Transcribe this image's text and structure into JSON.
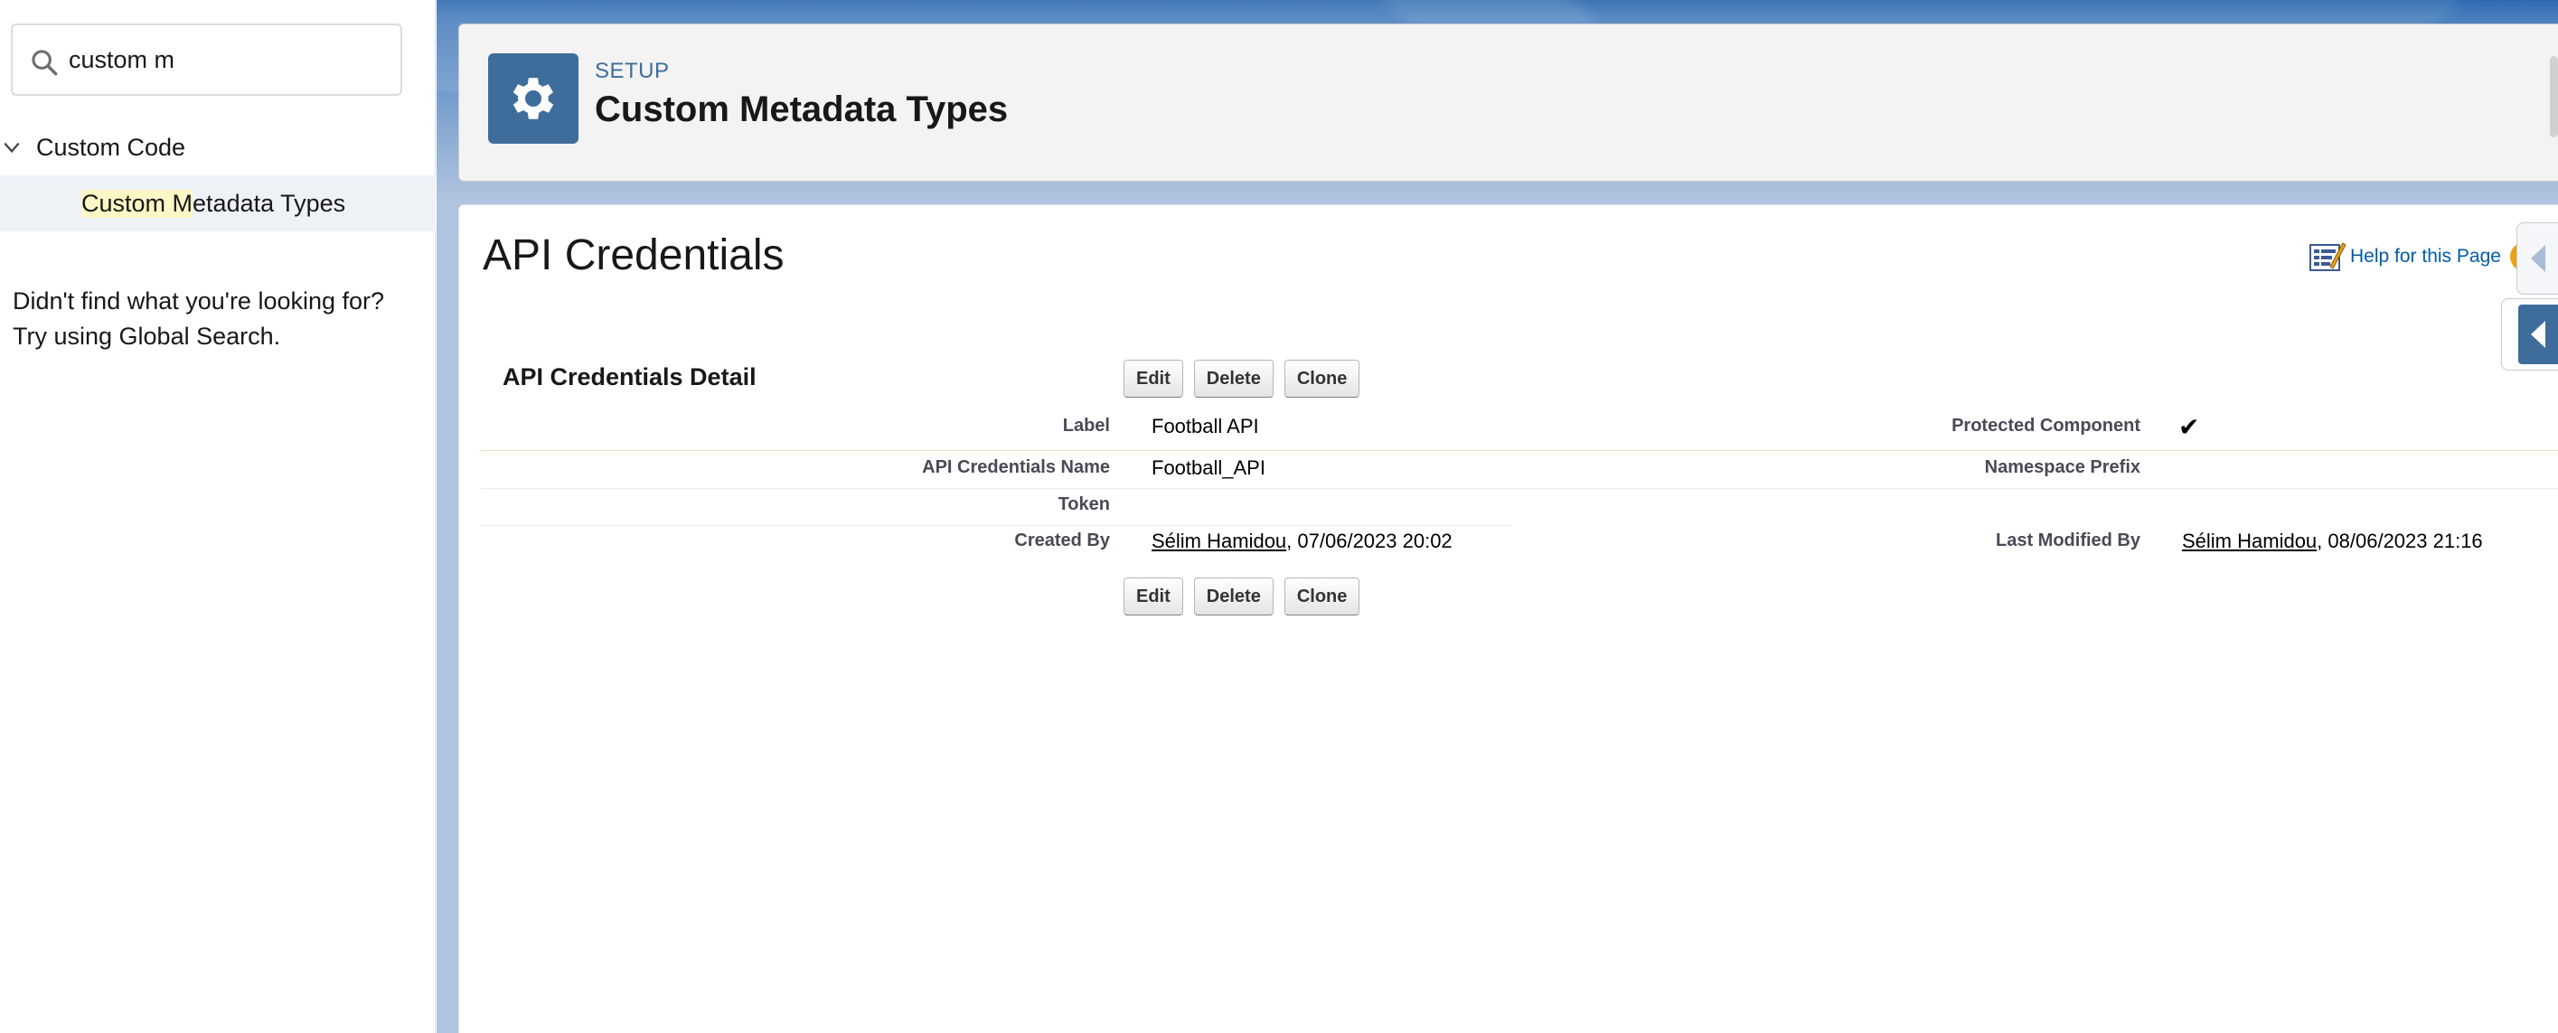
{
  "sidebar": {
    "search": {
      "value": "custom m",
      "icon": "search-icon"
    },
    "tree": {
      "group_label": "Custom Code",
      "item_highlight": "Custom M",
      "item_rest": "etadata Types"
    },
    "not_found_line1": "Didn't find what you're looking for?",
    "not_found_line2": "Try using Global Search."
  },
  "header": {
    "eyebrow": "SETUP",
    "title": "Custom Metadata Types",
    "icon": "gear-icon"
  },
  "page": {
    "heading": "API Credentials",
    "help_link": "Help for this Page",
    "help_badge": "?"
  },
  "detail": {
    "title": "API Credentials Detail",
    "buttons": {
      "edit": "Edit",
      "delete": "Delete",
      "clone": "Clone"
    },
    "label_label": "Label",
    "label_value": "Football API",
    "protected_label": "Protected Component",
    "protected_value": "✔",
    "api_name_label": "API Credentials Name",
    "api_name_value": "Football_API",
    "namespace_label": "Namespace Prefix",
    "namespace_value": "",
    "token_label": "Token",
    "token_value": "",
    "created_by_label": "Created By",
    "created_by_user": "Sélim Hamidou",
    "created_by_date": ", 07/06/2023 20:02",
    "modified_by_label": "Last Modified By",
    "modified_by_user": "Sélim Hamidou",
    "modified_by_date": ", 08/06/2023 21:16"
  },
  "colors": {
    "brand_blue": "#3e6d9c",
    "link_blue": "#015ba7",
    "highlight": "#fdf7c5",
    "help_badge": "#e8a317"
  }
}
